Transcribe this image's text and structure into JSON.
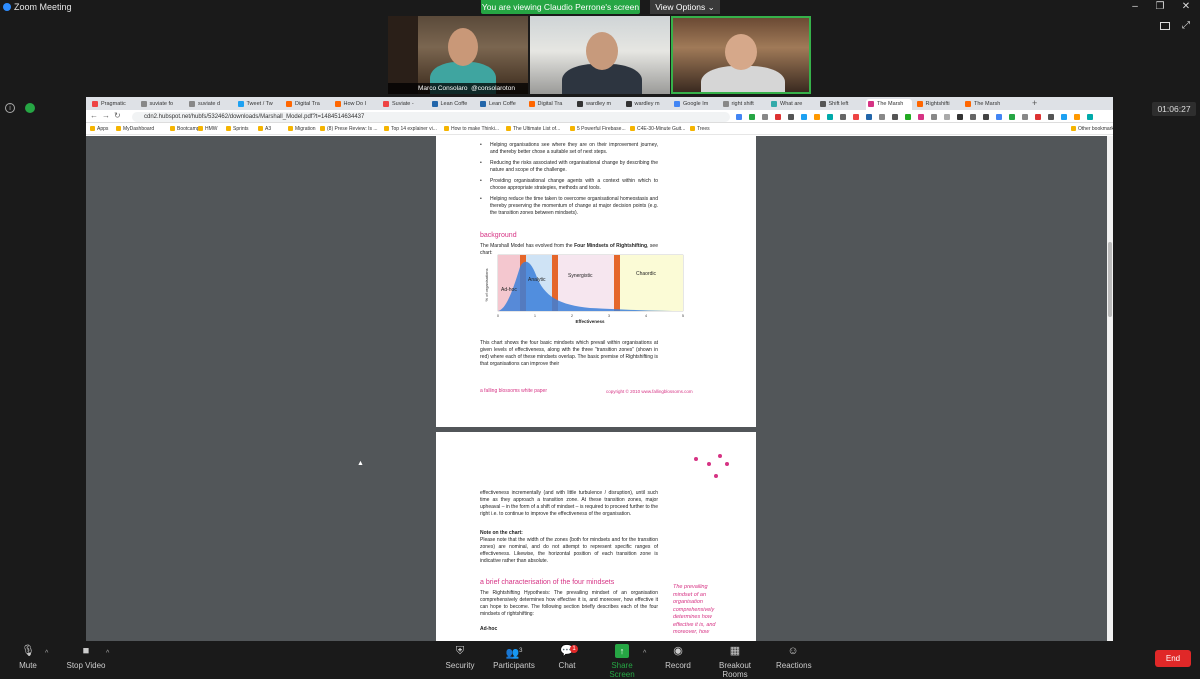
{
  "app": {
    "title": "Zoom Meeting"
  },
  "banner": {
    "text": "You are viewing Claudio Perrone's screen",
    "view_options": "View Options"
  },
  "videos": [
    {
      "name": "Marco Consolaro",
      "handle": "@consolaroton"
    },
    {
      "name": "",
      "handle": ""
    },
    {
      "name": "",
      "handle": ""
    }
  ],
  "timer": "01:06:27",
  "browser": {
    "tabs": [
      "Pragmatic",
      "suviate fo",
      "suviate d",
      "Tweet / Tw",
      "Digital Tra",
      "How Do I",
      "Suviate -",
      "Lean Coffe",
      "Lean Coffe",
      "Digital Tra",
      "wardley m",
      "wardley m",
      "Google Im",
      "right shift",
      "What are",
      "Shift left",
      "The Marsh",
      "Rightshifti",
      "The Marsh"
    ],
    "url": "cdn2.hubspot.net/hubfs/532462/downloads/Marshall_Model.pdf?t=1484514634437",
    "bookmarks": [
      "Apps",
      "MyDashboard",
      "Bootcamp",
      "HMW",
      "Sprints",
      "A3",
      "Migration",
      "(8) Prese Review: Is ...",
      "Top 14 explainer vi...",
      "How to make Thinki...",
      "The Ultimate List of...",
      "5 Powerful Firebase...",
      "C4E-30-Minute Guit...",
      "Trees",
      "Other bookmarks"
    ]
  },
  "document": {
    "bullets": [
      "Helping organisations see where they are on their improvement journey, and thereby better chose a suitable set of next steps.",
      "Reducing the risks associated with organisational change by describing the nature and scope of the challenge.",
      "Providing organisational change agents with a context within which to choose appropriate strategies, methods and tools.",
      "Helping reduce the time taken to overcome organisational homeostasis and thereby preserving the momentum of change at major decision points (e.g. the transition zones between mindsets)."
    ],
    "background_heading": "background",
    "background_text_1": "The Marshall Model has evolved from the ",
    "background_bold": "Four Mindsets of Rightshifting",
    "background_text_2": ", see chart:",
    "chart_caption": "This chart shows the four basic mindsets which prevail within organisations at given levels of effectiveness, along with the three “transition zones” (shown in red) where each of these mindsets overlap. The basic premise of Rightshifting is that organisations can improve their",
    "footer_left": "a falling blossoms white paper",
    "footer_right": "copyright © 2010 www.fallingblossoms.com",
    "page2_para": "effectiveness incrementally (and with little turbulence / disruption), until such time as they approach a transition zone. At these transition zones, major upheaval – in the form of a shift of mindset – is required to proceed further to the right i.e. to continue to improve the effectiveness of the organisation.",
    "note_heading": "Note on the chart:",
    "note_text": "Please note that the width of the zones (both for mindsets and for the transition zones) are nominal, and do not attempt to represent specific ranges of effectiveness. Likewise, the horizontal position of each transition zone is indicative rather than absolute.",
    "section_heading": "a brief characterisation of the four mindsets",
    "section_text": "The Rightshifting Hypothesis: The prevailing mindset of an organisation comprehensively determines how effective it is, and moreover, how effective it can hope to become. The following section briefly describes each of the four mindsets of rightshifting:",
    "adhoc_heading": "Ad-hoc",
    "side_quote": "The prevailing mindset of an organisation comprehensively determines how effective it is, and moreover, how"
  },
  "chart": {
    "ylabel": "% of organisations",
    "xlabel": "Effectiveness",
    "zones": [
      "Ad-hoc",
      "Analytic",
      "Synergistic",
      "Chaordic"
    ],
    "ticks": [
      "0",
      "1",
      "2",
      "3",
      "4",
      "5"
    ]
  },
  "toolbar": {
    "mute": "Mute",
    "stop_video": "Stop Video",
    "security": "Security",
    "participants": "Participants",
    "participants_count": "3",
    "chat": "Chat",
    "chat_badge": "1",
    "share": "Share Screen",
    "record": "Record",
    "breakout": "Breakout Rooms",
    "reactions": "Reactions",
    "end": "End"
  },
  "colors": {
    "zoom_green": "#26a644",
    "accent_pink": "#d63384",
    "end_red": "#e02828"
  }
}
